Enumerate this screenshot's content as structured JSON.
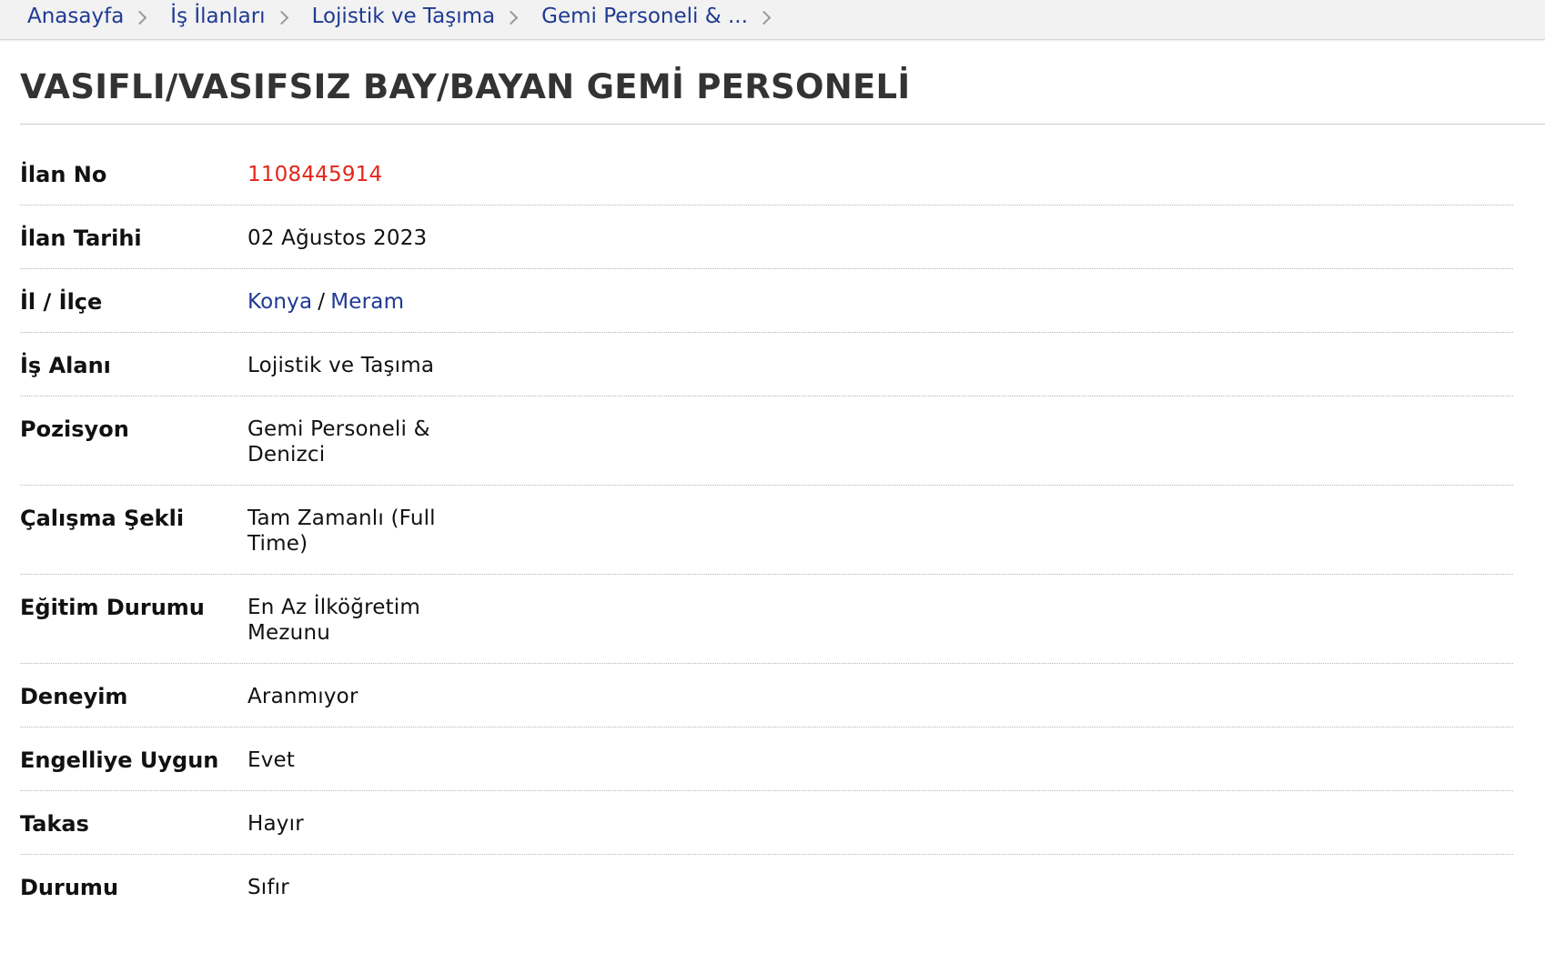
{
  "breadcrumb": [
    {
      "label": "Anasayfa"
    },
    {
      "label": "İş İlanları"
    },
    {
      "label": "Lojistik ve Taşıma"
    },
    {
      "label": "Gemi Personeli & ..."
    }
  ],
  "title": "VASIFLI/VASIFSIZ BAY/BAYAN GEMİ PERSONELİ",
  "details": {
    "ilan_no": {
      "label": "İlan No",
      "value": "1108445914"
    },
    "ilan_tarihi": {
      "label": "İlan Tarihi",
      "value": "02 Ağustos 2023"
    },
    "il_ilce": {
      "label": "İl / İlçe",
      "il": "Konya",
      "separator": "/",
      "ilce": "Meram"
    },
    "is_alani": {
      "label": "İş Alanı",
      "value": "Lojistik ve Taşıma"
    },
    "pozisyon": {
      "label": "Pozisyon",
      "value": "Gemi Personeli & Denizci"
    },
    "calisma_sekli": {
      "label": "Çalışma Şekli",
      "value": "Tam Zamanlı (Full Time)"
    },
    "egitim_durumu": {
      "label": "Eğitim Durumu",
      "value": "En Az İlköğretim Mezunu"
    },
    "deneyim": {
      "label": "Deneyim",
      "value": "Aranmıyor"
    },
    "engelliye_uygun": {
      "label": "Engelliye Uygun",
      "value": "Evet"
    },
    "takas": {
      "label": "Takas",
      "value": "Hayır"
    },
    "durumu": {
      "label": "Durumu",
      "value": "Sıfır"
    }
  },
  "colors": {
    "link": "#1f3a93",
    "ilan_no": "#e3261b",
    "breadcrumb_bg": "#f2f2f2"
  },
  "icons": {
    "breadcrumb_separator": "chevron-right-icon"
  }
}
